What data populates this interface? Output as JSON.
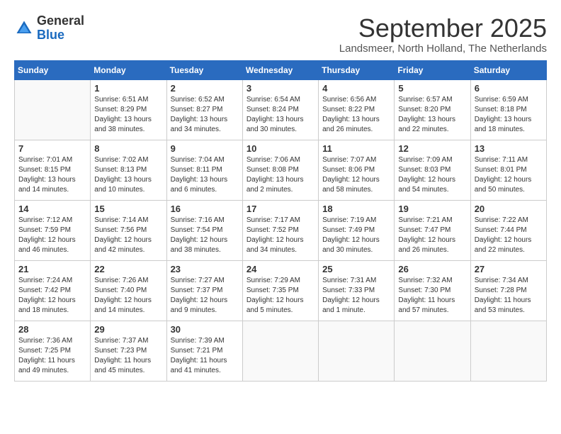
{
  "logo": {
    "general": "General",
    "blue": "Blue"
  },
  "header": {
    "month": "September 2025",
    "location": "Landsmeer, North Holland, The Netherlands"
  },
  "weekdays": [
    "Sunday",
    "Monday",
    "Tuesday",
    "Wednesday",
    "Thursday",
    "Friday",
    "Saturday"
  ],
  "weeks": [
    [
      {
        "day": "",
        "info": ""
      },
      {
        "day": "1",
        "info": "Sunrise: 6:51 AM\nSunset: 8:29 PM\nDaylight: 13 hours\nand 38 minutes."
      },
      {
        "day": "2",
        "info": "Sunrise: 6:52 AM\nSunset: 8:27 PM\nDaylight: 13 hours\nand 34 minutes."
      },
      {
        "day": "3",
        "info": "Sunrise: 6:54 AM\nSunset: 8:24 PM\nDaylight: 13 hours\nand 30 minutes."
      },
      {
        "day": "4",
        "info": "Sunrise: 6:56 AM\nSunset: 8:22 PM\nDaylight: 13 hours\nand 26 minutes."
      },
      {
        "day": "5",
        "info": "Sunrise: 6:57 AM\nSunset: 8:20 PM\nDaylight: 13 hours\nand 22 minutes."
      },
      {
        "day": "6",
        "info": "Sunrise: 6:59 AM\nSunset: 8:18 PM\nDaylight: 13 hours\nand 18 minutes."
      }
    ],
    [
      {
        "day": "7",
        "info": "Sunrise: 7:01 AM\nSunset: 8:15 PM\nDaylight: 13 hours\nand 14 minutes."
      },
      {
        "day": "8",
        "info": "Sunrise: 7:02 AM\nSunset: 8:13 PM\nDaylight: 13 hours\nand 10 minutes."
      },
      {
        "day": "9",
        "info": "Sunrise: 7:04 AM\nSunset: 8:11 PM\nDaylight: 13 hours\nand 6 minutes."
      },
      {
        "day": "10",
        "info": "Sunrise: 7:06 AM\nSunset: 8:08 PM\nDaylight: 13 hours\nand 2 minutes."
      },
      {
        "day": "11",
        "info": "Sunrise: 7:07 AM\nSunset: 8:06 PM\nDaylight: 12 hours\nand 58 minutes."
      },
      {
        "day": "12",
        "info": "Sunrise: 7:09 AM\nSunset: 8:03 PM\nDaylight: 12 hours\nand 54 minutes."
      },
      {
        "day": "13",
        "info": "Sunrise: 7:11 AM\nSunset: 8:01 PM\nDaylight: 12 hours\nand 50 minutes."
      }
    ],
    [
      {
        "day": "14",
        "info": "Sunrise: 7:12 AM\nSunset: 7:59 PM\nDaylight: 12 hours\nand 46 minutes."
      },
      {
        "day": "15",
        "info": "Sunrise: 7:14 AM\nSunset: 7:56 PM\nDaylight: 12 hours\nand 42 minutes."
      },
      {
        "day": "16",
        "info": "Sunrise: 7:16 AM\nSunset: 7:54 PM\nDaylight: 12 hours\nand 38 minutes."
      },
      {
        "day": "17",
        "info": "Sunrise: 7:17 AM\nSunset: 7:52 PM\nDaylight: 12 hours\nand 34 minutes."
      },
      {
        "day": "18",
        "info": "Sunrise: 7:19 AM\nSunset: 7:49 PM\nDaylight: 12 hours\nand 30 minutes."
      },
      {
        "day": "19",
        "info": "Sunrise: 7:21 AM\nSunset: 7:47 PM\nDaylight: 12 hours\nand 26 minutes."
      },
      {
        "day": "20",
        "info": "Sunrise: 7:22 AM\nSunset: 7:44 PM\nDaylight: 12 hours\nand 22 minutes."
      }
    ],
    [
      {
        "day": "21",
        "info": "Sunrise: 7:24 AM\nSunset: 7:42 PM\nDaylight: 12 hours\nand 18 minutes."
      },
      {
        "day": "22",
        "info": "Sunrise: 7:26 AM\nSunset: 7:40 PM\nDaylight: 12 hours\nand 14 minutes."
      },
      {
        "day": "23",
        "info": "Sunrise: 7:27 AM\nSunset: 7:37 PM\nDaylight: 12 hours\nand 9 minutes."
      },
      {
        "day": "24",
        "info": "Sunrise: 7:29 AM\nSunset: 7:35 PM\nDaylight: 12 hours\nand 5 minutes."
      },
      {
        "day": "25",
        "info": "Sunrise: 7:31 AM\nSunset: 7:33 PM\nDaylight: 12 hours\nand 1 minute."
      },
      {
        "day": "26",
        "info": "Sunrise: 7:32 AM\nSunset: 7:30 PM\nDaylight: 11 hours\nand 57 minutes."
      },
      {
        "day": "27",
        "info": "Sunrise: 7:34 AM\nSunset: 7:28 PM\nDaylight: 11 hours\nand 53 minutes."
      }
    ],
    [
      {
        "day": "28",
        "info": "Sunrise: 7:36 AM\nSunset: 7:25 PM\nDaylight: 11 hours\nand 49 minutes."
      },
      {
        "day": "29",
        "info": "Sunrise: 7:37 AM\nSunset: 7:23 PM\nDaylight: 11 hours\nand 45 minutes."
      },
      {
        "day": "30",
        "info": "Sunrise: 7:39 AM\nSunset: 7:21 PM\nDaylight: 11 hours\nand 41 minutes."
      },
      {
        "day": "",
        "info": ""
      },
      {
        "day": "",
        "info": ""
      },
      {
        "day": "",
        "info": ""
      },
      {
        "day": "",
        "info": ""
      }
    ]
  ]
}
